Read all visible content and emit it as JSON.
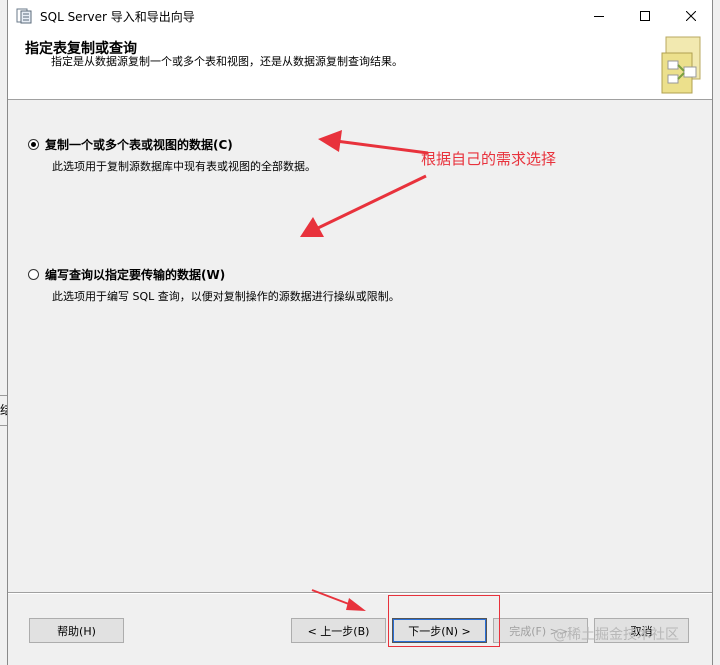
{
  "window": {
    "title": "SQL Server 导入和导出向导"
  },
  "header": {
    "title": "指定表复制或查询",
    "description": "指定是从数据源复制一个或多个表和视图，还是从数据源复制查询结果。"
  },
  "options": [
    {
      "label": "复制一个或多个表或视图的数据(C)",
      "description": "此选项用于复制源数据库中现有表或视图的全部数据。",
      "selected": true
    },
    {
      "label": "编写查询以指定要传输的数据(W)",
      "description": "此选项用于编写 SQL 查询，以便对复制操作的源数据进行操纵或限制。",
      "selected": false
    }
  ],
  "annotation": {
    "text": "根据自己的需求选择",
    "color": "#e8323c"
  },
  "footer": {
    "help": "帮助(H)",
    "back": "< 上一步(B)",
    "next": "下一步(N) >",
    "finish": "完成(F) >>|",
    "cancel": "取消"
  },
  "background": {
    "edge_text": "结"
  },
  "watermark": "@稀土掘金技术社区"
}
